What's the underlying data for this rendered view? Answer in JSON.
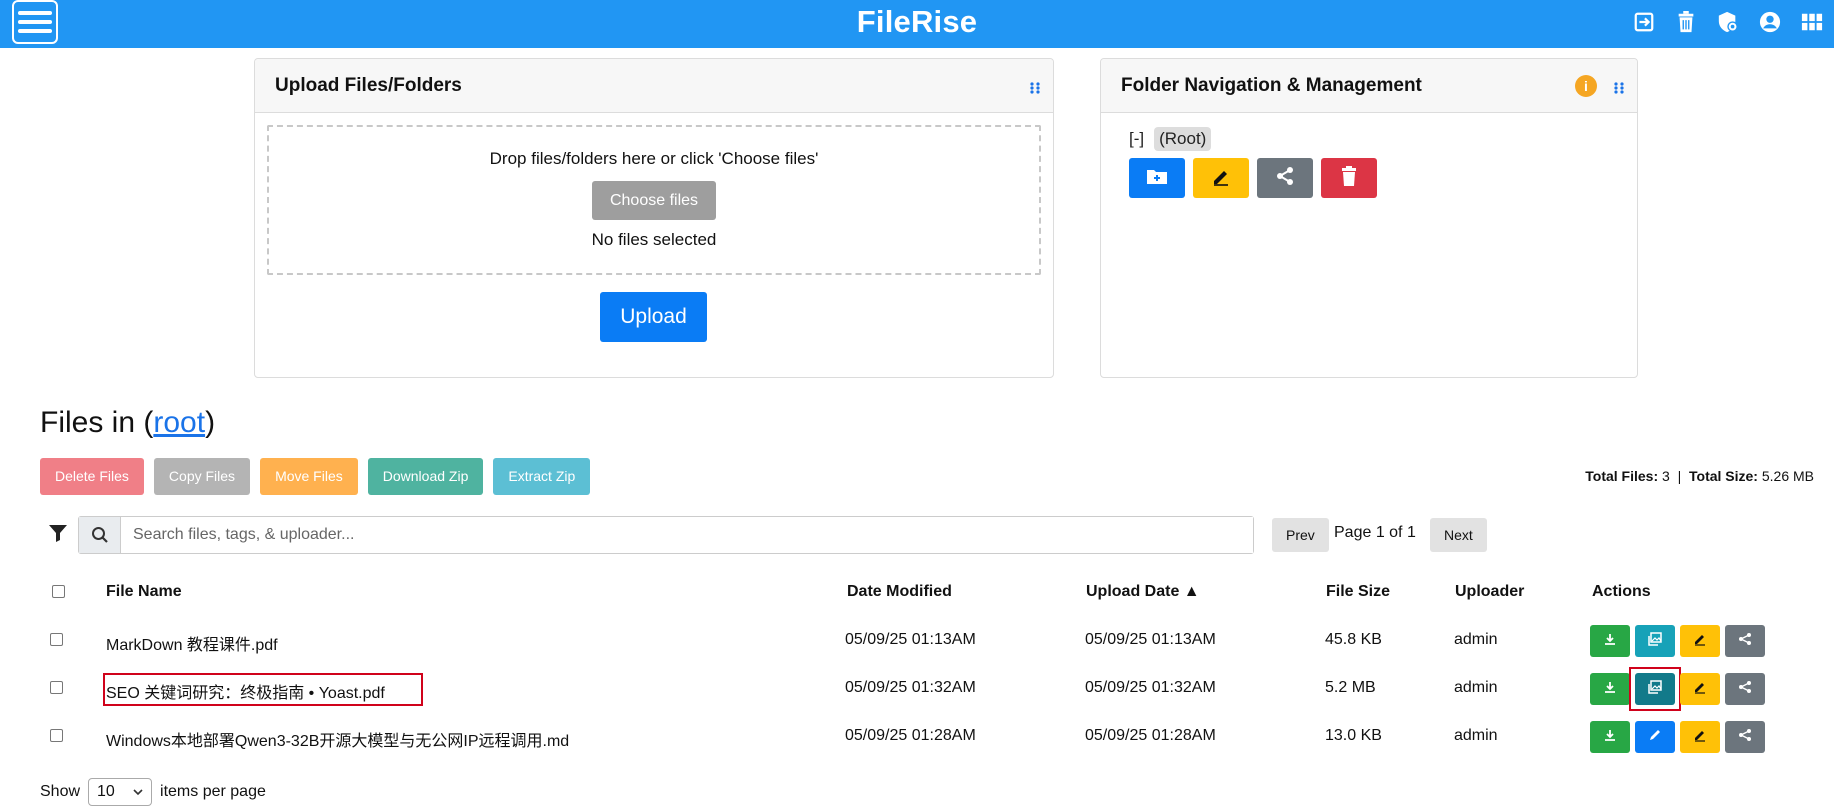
{
  "app": {
    "title": "FileRise"
  },
  "header": {
    "icons": [
      "logout-icon",
      "trash-bin-icon",
      "admin-shield-icon",
      "user-circle-icon",
      "grid-icon"
    ]
  },
  "upload_card": {
    "title": "Upload Files/Folders",
    "drop_text": "Drop files/folders here or click 'Choose files'",
    "choose_label": "Choose files",
    "no_files_text": "No files selected",
    "upload_label": "Upload"
  },
  "folder_card": {
    "title": "Folder Navigation & Management",
    "tree_toggle": "[-]",
    "root_label": "(Root)",
    "info_label": "i",
    "buttons": [
      "create-folder",
      "rename-folder",
      "share-folder",
      "delete-folder"
    ]
  },
  "files": {
    "title_prefix": "Files in (",
    "folder": "root",
    "title_suffix": ")",
    "bulk_actions": [
      "Delete Files",
      "Copy Files",
      "Move Files",
      "Download Zip",
      "Extract Zip"
    ],
    "totals": {
      "files_label": "Total Files:",
      "files_value": "3",
      "sep": "|",
      "size_label": "Total Size:",
      "size_value": "5.26 MB"
    },
    "search_placeholder": "Search files, tags, & uploader...",
    "pagination": {
      "prev": "Prev",
      "page_text": "Page 1 of 1",
      "next": "Next"
    },
    "columns": [
      "File Name",
      "Date Modified",
      "Upload Date ▲",
      "File Size",
      "Uploader",
      "Actions"
    ],
    "rows": [
      {
        "name": "MarkDown 教程课件.pdf",
        "modified": "05/09/25 01:13AM",
        "uploaded": "05/09/25 01:13AM",
        "size": "45.8 KB",
        "uploader": "admin"
      },
      {
        "name": "SEO 关键词研究：终极指南 • Yoast.pdf",
        "modified": "05/09/25 01:32AM",
        "uploaded": "05/09/25 01:32AM",
        "size": "5.2 MB",
        "uploader": "admin"
      },
      {
        "name": "Windows本地部署Qwen3-32B开源大模型与无公网IP远程调用.md",
        "modified": "05/09/25 01:28AM",
        "uploaded": "05/09/25 01:28AM",
        "size": "13.0 KB",
        "uploader": "admin"
      }
    ],
    "show_label": "Show",
    "per_page": "10",
    "per_page_suffix": "items per page"
  },
  "colors": {
    "header": "#2196f3",
    "primary": "#0a7cf5",
    "success": "#28a745",
    "info": "#17a2b8",
    "warning": "#ffc107",
    "secondary": "#6c757d",
    "danger": "#dc3545"
  }
}
